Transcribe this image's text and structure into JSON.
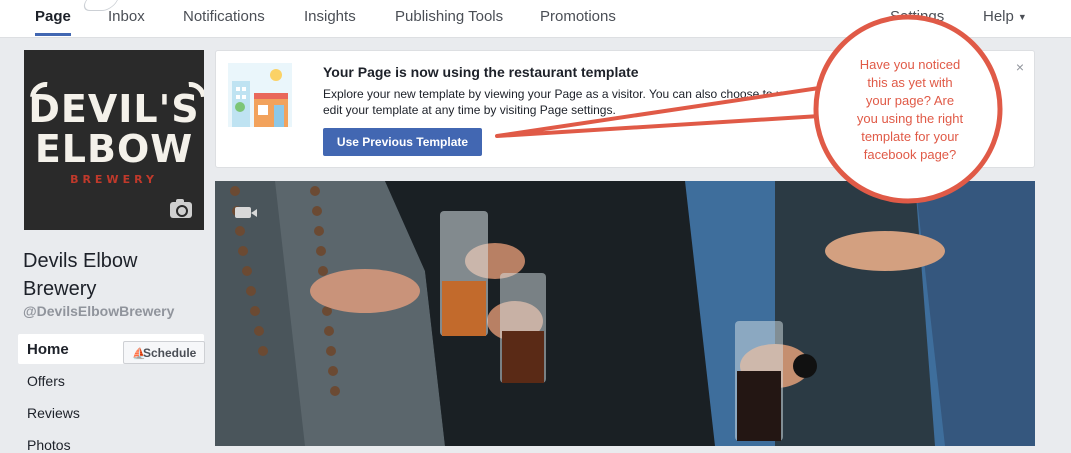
{
  "topnav": {
    "tabs": [
      {
        "label": "Page",
        "active": true
      },
      {
        "label": "Inbox"
      },
      {
        "label": "Notifications"
      },
      {
        "label": "Insights"
      },
      {
        "label": "Publishing Tools"
      },
      {
        "label": "Promotions"
      }
    ],
    "settings_label": "Settings",
    "help_label": "Help"
  },
  "page": {
    "logo": {
      "line1": "DEVIL'S",
      "line2": "ELBOW",
      "line3": "BREWERY"
    },
    "name_line1": "Devils Elbow",
    "name_line2": "Brewery",
    "handle": "@DevilsElbowBrewery"
  },
  "sidebar": {
    "items": [
      {
        "label": "Home",
        "active": true
      },
      {
        "label": "Offers"
      },
      {
        "label": "Reviews"
      },
      {
        "label": "Photos"
      }
    ],
    "schedule_label": "Schedule"
  },
  "notice": {
    "title": "Your Page is now using the restaurant template",
    "body_line1": "Explore your new template by viewing your Page as a visitor. You can also choose to us",
    "body_line2": "edit your template at any time by visiting Page settings.",
    "button_label": "Use Previous Template",
    "close_icon": "×"
  },
  "callout": {
    "lines": [
      "Have you noticed",
      "this as yet with",
      "your page? Are",
      "you using the right",
      "template for your",
      "facebook page?"
    ],
    "color": "#e05a47"
  },
  "colors": {
    "accent": "#4267b2",
    "background": "#e9ebee",
    "callout_red": "#e05a47"
  },
  "icons": {
    "camera": "camera-icon",
    "video": "video-icon",
    "schedule": "schedule-icon",
    "close": "close-icon",
    "caret": "chevron-down-icon"
  }
}
